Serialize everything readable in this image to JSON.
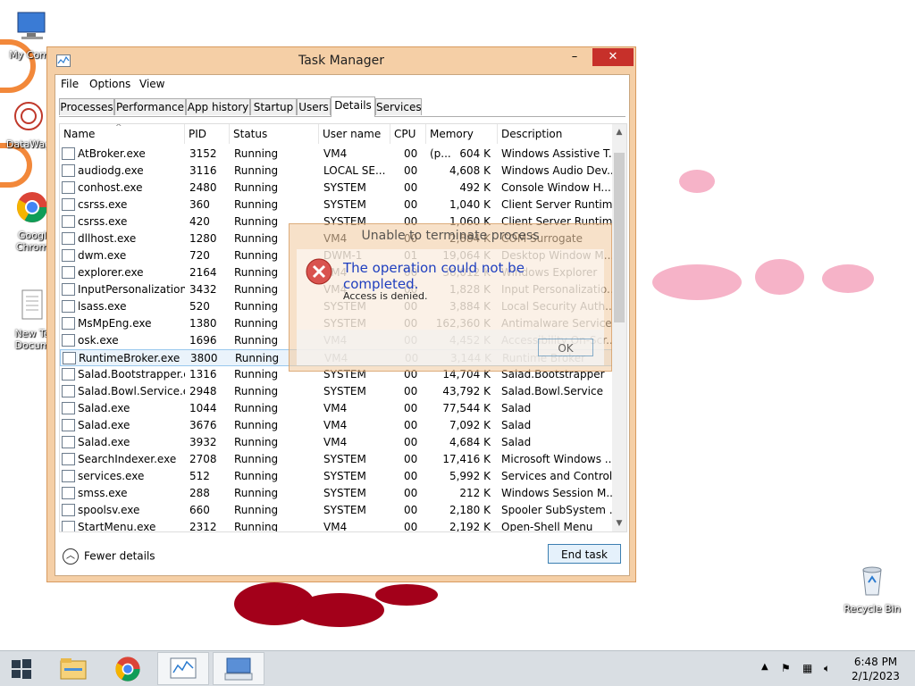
{
  "desktop": {
    "icons": [
      {
        "label": "My Comp"
      },
      {
        "label": "DataWag"
      },
      {
        "label": "Googl Chrom"
      },
      {
        "label": "New Te Docum"
      },
      {
        "label": "Recycle Bin"
      }
    ]
  },
  "window": {
    "title": "Task Manager",
    "minimize_label": "–",
    "close_label": "✕",
    "menu": [
      "File",
      "Options",
      "View"
    ],
    "tabs": [
      "Processes",
      "Performance",
      "App history",
      "Startup",
      "Users",
      "Details",
      "Services"
    ],
    "active_tab": "Details",
    "columns": [
      "Name",
      "PID",
      "Status",
      "User name",
      "CPU",
      "Memory (p...",
      "Description"
    ],
    "rows": [
      {
        "name": "AtBroker.exe",
        "pid": "3152",
        "status": "Running",
        "user": "VM4",
        "cpu": "00",
        "mem": "604 K",
        "desc": "Windows Assistive T..."
      },
      {
        "name": "audiodg.exe",
        "pid": "3116",
        "status": "Running",
        "user": "LOCAL SE...",
        "cpu": "00",
        "mem": "4,608 K",
        "desc": "Windows Audio Dev..."
      },
      {
        "name": "conhost.exe",
        "pid": "2480",
        "status": "Running",
        "user": "SYSTEM",
        "cpu": "00",
        "mem": "492 K",
        "desc": "Console Window H..."
      },
      {
        "name": "csrss.exe",
        "pid": "360",
        "status": "Running",
        "user": "SYSTEM",
        "cpu": "00",
        "mem": "1,040 K",
        "desc": "Client Server Runtim..."
      },
      {
        "name": "csrss.exe",
        "pid": "420",
        "status": "Running",
        "user": "SYSTEM",
        "cpu": "00",
        "mem": "1,060 K",
        "desc": "Client Server Runtim..."
      },
      {
        "name": "dllhost.exe",
        "pid": "1280",
        "status": "Running",
        "user": "VM4",
        "cpu": "00",
        "mem": "2,884 K",
        "desc": "COM Surrogate"
      },
      {
        "name": "dwm.exe",
        "pid": "720",
        "status": "Running",
        "user": "DWM-1",
        "cpu": "01",
        "mem": "19,064 K",
        "desc": "Desktop Window M..."
      },
      {
        "name": "explorer.exe",
        "pid": "2164",
        "status": "Running",
        "user": "VM4",
        "cpu": "00",
        "mem": "36,012 K",
        "desc": "Windows Explorer"
      },
      {
        "name": "InputPersonalization...",
        "pid": "3432",
        "status": "Running",
        "user": "VM4",
        "cpu": "00",
        "mem": "1,828 K",
        "desc": "Input Personalizatio..."
      },
      {
        "name": "lsass.exe",
        "pid": "520",
        "status": "Running",
        "user": "SYSTEM",
        "cpu": "00",
        "mem": "3,884 K",
        "desc": "Local Security Auth..."
      },
      {
        "name": "MsMpEng.exe",
        "pid": "1380",
        "status": "Running",
        "user": "SYSTEM",
        "cpu": "00",
        "mem": "162,360 K",
        "desc": "Antimalware Service..."
      },
      {
        "name": "osk.exe",
        "pid": "1696",
        "status": "Running",
        "user": "VM4",
        "cpu": "00",
        "mem": "4,452 K",
        "desc": "Accessibility On-Scr..."
      },
      {
        "name": "RuntimeBroker.exe",
        "pid": "3800",
        "status": "Running",
        "user": "VM4",
        "cpu": "00",
        "mem": "3,144 K",
        "desc": "Runtime Broker"
      },
      {
        "name": "Salad.Bootstrapper.exe",
        "pid": "1316",
        "status": "Running",
        "user": "SYSTEM",
        "cpu": "00",
        "mem": "14,704 K",
        "desc": "Salad.Bootstrapper"
      },
      {
        "name": "Salad.Bowl.Service.exe",
        "pid": "2948",
        "status": "Running",
        "user": "SYSTEM",
        "cpu": "00",
        "mem": "43,792 K",
        "desc": "Salad.Bowl.Service"
      },
      {
        "name": "Salad.exe",
        "pid": "1044",
        "status": "Running",
        "user": "VM4",
        "cpu": "00",
        "mem": "77,544 K",
        "desc": "Salad"
      },
      {
        "name": "Salad.exe",
        "pid": "3676",
        "status": "Running",
        "user": "VM4",
        "cpu": "00",
        "mem": "7,092 K",
        "desc": "Salad"
      },
      {
        "name": "Salad.exe",
        "pid": "3932",
        "status": "Running",
        "user": "VM4",
        "cpu": "00",
        "mem": "4,684 K",
        "desc": "Salad"
      },
      {
        "name": "SearchIndexer.exe",
        "pid": "2708",
        "status": "Running",
        "user": "SYSTEM",
        "cpu": "00",
        "mem": "17,416 K",
        "desc": "Microsoft Windows ..."
      },
      {
        "name": "services.exe",
        "pid": "512",
        "status": "Running",
        "user": "SYSTEM",
        "cpu": "00",
        "mem": "5,992 K",
        "desc": "Services and Control..."
      },
      {
        "name": "smss.exe",
        "pid": "288",
        "status": "Running",
        "user": "SYSTEM",
        "cpu": "00",
        "mem": "212 K",
        "desc": "Windows Session M..."
      },
      {
        "name": "spoolsv.exe",
        "pid": "660",
        "status": "Running",
        "user": "SYSTEM",
        "cpu": "00",
        "mem": "2,180 K",
        "desc": "Spooler SubSystem ..."
      },
      {
        "name": "StartMenu.exe",
        "pid": "2312",
        "status": "Running",
        "user": "VM4",
        "cpu": "00",
        "mem": "2,192 K",
        "desc": "Open-Shell Menu"
      }
    ],
    "selected_row": "RuntimeBroker.exe",
    "fewer_details_label": "Fewer details",
    "end_task_label": "End task"
  },
  "dialog": {
    "title": "Unable to terminate process",
    "main_message": "The operation could not be completed.",
    "sub_message": "Access is denied.",
    "ok_label": "OK"
  },
  "taskbar": {
    "time": "6:48 PM",
    "date": "2/1/2023"
  },
  "colors": {
    "window_frame": "#f5cfa6",
    "close_button": "#c7302a",
    "selection": "#eaf3fb",
    "dialog_message": "#1f3fbf",
    "splash_pink": "#f4a6c0",
    "splash_red": "#a3001a",
    "taskbar": "#d9dee3"
  }
}
